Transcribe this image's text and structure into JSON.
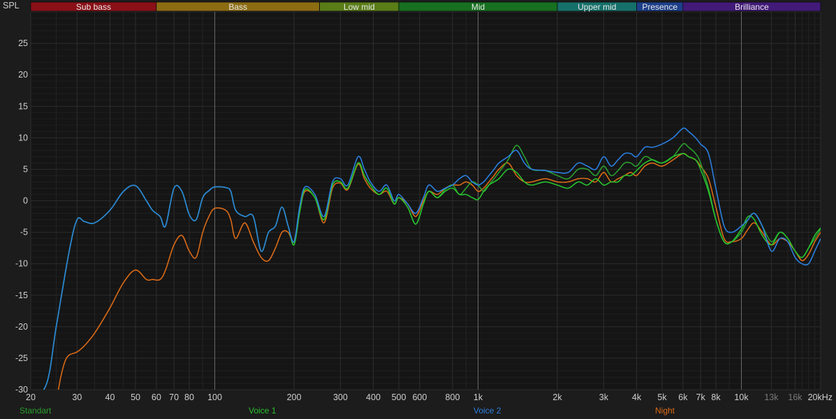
{
  "chart_data": {
    "type": "line",
    "ylabel": "SPL",
    "x_unit_label": "20kHz",
    "x_scale": "log",
    "xlim": [
      20,
      20000
    ],
    "ylim": [
      -30,
      30
    ],
    "grid": true,
    "y_ticks": [
      25,
      20,
      15,
      10,
      5,
      0,
      -5,
      -10,
      -15,
      -20,
      -25,
      -30
    ],
    "x_ticks": [
      {
        "v": 20,
        "label": "20",
        "dim": false
      },
      {
        "v": 30,
        "label": "30",
        "dim": false
      },
      {
        "v": 40,
        "label": "40",
        "dim": false
      },
      {
        "v": 50,
        "label": "50",
        "dim": false
      },
      {
        "v": 60,
        "label": "60",
        "dim": false
      },
      {
        "v": 70,
        "label": "70",
        "dim": false
      },
      {
        "v": 80,
        "label": "80",
        "dim": false
      },
      {
        "v": 100,
        "label": "100",
        "dim": false
      },
      {
        "v": 200,
        "label": "200",
        "dim": false
      },
      {
        "v": 300,
        "label": "300",
        "dim": false
      },
      {
        "v": 400,
        "label": "400",
        "dim": false
      },
      {
        "v": 500,
        "label": "500",
        "dim": false
      },
      {
        "v": 600,
        "label": "600",
        "dim": false
      },
      {
        "v": 800,
        "label": "800",
        "dim": false
      },
      {
        "v": 1000,
        "label": "1k",
        "dim": false
      },
      {
        "v": 2000,
        "label": "2k",
        "dim": false
      },
      {
        "v": 3000,
        "label": "3k",
        "dim": false
      },
      {
        "v": 4000,
        "label": "4k",
        "dim": false
      },
      {
        "v": 5000,
        "label": "5k",
        "dim": false
      },
      {
        "v": 6000,
        "label": "6k",
        "dim": false
      },
      {
        "v": 7000,
        "label": "7k",
        "dim": false
      },
      {
        "v": 8000,
        "label": "8k",
        "dim": false
      },
      {
        "v": 10000,
        "label": "10k",
        "dim": false
      },
      {
        "v": 13000,
        "label": "13k",
        "dim": true
      },
      {
        "v": 16000,
        "label": "16k",
        "dim": true
      },
      {
        "v": 20000,
        "label": "20kHz",
        "dim": false
      }
    ],
    "bands": [
      {
        "name": "Sub bass",
        "from": 20,
        "to": 60,
        "color": "#8a1017"
      },
      {
        "name": "Bass",
        "from": 60,
        "to": 250,
        "color": "#8c6d12"
      },
      {
        "name": "Low mid",
        "from": 250,
        "to": 500,
        "color": "#5a7d18"
      },
      {
        "name": "Mid",
        "from": 500,
        "to": 2000,
        "color": "#17701f"
      },
      {
        "name": "Upper mid",
        "from": 2000,
        "to": 4000,
        "color": "#16706a"
      },
      {
        "name": "Presence",
        "from": 4000,
        "to": 6000,
        "color": "#1d3f8a"
      },
      {
        "name": "Brilliance",
        "from": 6000,
        "to": 20000,
        "color": "#421a78"
      }
    ],
    "series": [
      {
        "name": "Standart",
        "color": "#2a9e2e",
        "x": [
          20,
          23,
          25,
          28,
          30,
          32,
          35,
          40,
          45,
          50,
          55,
          58,
          62,
          65,
          70,
          75,
          80,
          85,
          90,
          95,
          100,
          110,
          115,
          120,
          130,
          140,
          150,
          160,
          170,
          180,
          190,
          200,
          210,
          220,
          240,
          260,
          280,
          300,
          320,
          350,
          370,
          390,
          420,
          450,
          480,
          500,
          540,
          580,
          620,
          650,
          700,
          750,
          800,
          850,
          900,
          950,
          1000,
          1050,
          1100,
          1150,
          1200,
          1300,
          1400,
          1500,
          1600,
          1800,
          2000,
          2200,
          2400,
          2600,
          2800,
          3000,
          3200,
          3400,
          3600,
          3800,
          4000,
          4300,
          4600,
          5000,
          5500,
          6000,
          6300,
          6700,
          7000,
          7500,
          8000,
          8600,
          9200,
          10000,
          10600,
          11200,
          12000,
          13000,
          14000,
          15000,
          16000,
          17000,
          18000,
          19000,
          20000
        ],
        "y": [
          -32,
          -29,
          -20,
          -8,
          -3,
          -3.3,
          -3.5,
          -1.5,
          1.5,
          2.4,
          0,
          -1.5,
          -2.5,
          -4,
          2,
          1.5,
          -2.2,
          -3,
          0.5,
          1.6,
          2.2,
          2.1,
          1.5,
          -1.5,
          -2.5,
          -2.5,
          -8,
          -5,
          -4,
          -1,
          -4,
          -7,
          -1.8,
          1.8,
          0.5,
          -3,
          2.5,
          3,
          2,
          6,
          4,
          2.5,
          1,
          2,
          -0.5,
          0.5,
          -1,
          -3.7,
          -0.5,
          1.5,
          0.5,
          1.8,
          2.5,
          1,
          2,
          3,
          2.5,
          1.5,
          2.5,
          3.5,
          4.5,
          6.5,
          8.8,
          7,
          5,
          4.8,
          4,
          3.5,
          5,
          5,
          4,
          5.5,
          4,
          4.8,
          6,
          6,
          5.5,
          7,
          6.5,
          6,
          7,
          9,
          8.5,
          7.5,
          6,
          2,
          -3,
          -6.5,
          -6.5,
          -5,
          -3,
          -2,
          -4,
          -6.5,
          -5,
          -6,
          -8,
          -9,
          -7.5,
          -6,
          -4.5
        ]
      },
      {
        "name": "Voice 1",
        "color": "#27c22e",
        "x": [
          20,
          23,
          25,
          28,
          30,
          32,
          35,
          40,
          45,
          50,
          55,
          58,
          62,
          65,
          70,
          75,
          80,
          85,
          90,
          95,
          100,
          110,
          115,
          120,
          130,
          140,
          150,
          160,
          170,
          180,
          190,
          200,
          210,
          220,
          240,
          260,
          280,
          300,
          320,
          350,
          370,
          390,
          420,
          450,
          480,
          500,
          540,
          580,
          620,
          650,
          700,
          750,
          800,
          850,
          900,
          950,
          1000,
          1050,
          1100,
          1150,
          1200,
          1300,
          1400,
          1500,
          1600,
          1800,
          2000,
          2200,
          2400,
          2600,
          2800,
          3000,
          3200,
          3400,
          3600,
          3800,
          4000,
          4300,
          4600,
          5000,
          5500,
          6000,
          6300,
          6700,
          7000,
          7500,
          8000,
          8600,
          9200,
          10000,
          10600,
          11200,
          12000,
          13000,
          14000,
          15000,
          16000,
          17000,
          18000,
          19000,
          20000
        ],
        "y": [
          -32,
          -29,
          -20,
          -8,
          -3,
          -3.3,
          -3.5,
          -1.5,
          1.5,
          2.4,
          0,
          -1.5,
          -2.5,
          -4,
          2,
          1.5,
          -2.2,
          -3,
          0.5,
          1.6,
          2.2,
          2.1,
          1.5,
          -1.5,
          -2.5,
          -2.5,
          -8,
          -5,
          -4,
          -1,
          -4,
          -7,
          -1.8,
          1.8,
          0.5,
          -3,
          2.5,
          3,
          2,
          6,
          4,
          2.5,
          1,
          2,
          -0.5,
          0.5,
          -1,
          -3.7,
          -0.5,
          1.5,
          0.5,
          1.5,
          2,
          1,
          1,
          0.5,
          0.2,
          1.5,
          2.5,
          3,
          3.5,
          5,
          4.5,
          3,
          2.5,
          3,
          2.5,
          2,
          3,
          2.5,
          3.5,
          2.5,
          3,
          3,
          4,
          4,
          4.8,
          6,
          6.5,
          6,
          7,
          7.5,
          7,
          6.5,
          5,
          1.5,
          -3,
          -6.5,
          -6.5,
          -4.5,
          -2.5,
          -3,
          -5.5,
          -7,
          -5,
          -6,
          -8,
          -9,
          -7.5,
          -5.5,
          -4.3
        ]
      },
      {
        "name": "Voice 2",
        "color": "#2b7fe0",
        "x": [
          20,
          23,
          25,
          28,
          30,
          32,
          35,
          40,
          45,
          50,
          55,
          58,
          62,
          65,
          70,
          75,
          80,
          85,
          90,
          95,
          100,
          110,
          115,
          120,
          130,
          140,
          150,
          160,
          170,
          180,
          190,
          200,
          210,
          220,
          240,
          260,
          280,
          300,
          320,
          350,
          370,
          390,
          420,
          450,
          480,
          500,
          540,
          580,
          620,
          650,
          700,
          750,
          800,
          850,
          900,
          950,
          1000,
          1050,
          1100,
          1150,
          1200,
          1300,
          1400,
          1500,
          1600,
          1800,
          2000,
          2200,
          2400,
          2600,
          2800,
          3000,
          3200,
          3400,
          3600,
          3800,
          4000,
          4300,
          4600,
          5000,
          5500,
          6000,
          6300,
          6700,
          7000,
          7500,
          8000,
          8600,
          9200,
          10000,
          10600,
          11200,
          12000,
          13000,
          14000,
          15000,
          16000,
          17000,
          18000,
          19000,
          20000
        ],
        "y": [
          -32,
          -29,
          -20,
          -8,
          -3,
          -3.3,
          -3.5,
          -1.5,
          1.5,
          2.4,
          0,
          -1.5,
          -2.5,
          -4,
          2,
          1.5,
          -2.2,
          -3,
          0.5,
          1.6,
          2.2,
          2.1,
          1.5,
          -1.5,
          -2.5,
          -2.5,
          -8,
          -5,
          -4,
          -1,
          -4,
          -6.5,
          -1,
          2.2,
          1,
          -2.5,
          3,
          3.5,
          2.5,
          7,
          5,
          3,
          1.5,
          2.5,
          0,
          1,
          -0.5,
          -2,
          0.5,
          2.5,
          1.5,
          2,
          2.5,
          3.5,
          4,
          3,
          2.5,
          3,
          4,
          5,
          6,
          7,
          8,
          6,
          5,
          4.8,
          4.5,
          4.5,
          6,
          5.5,
          5,
          7,
          5.5,
          6.5,
          7.5,
          7.5,
          7,
          8.5,
          8.5,
          9,
          10,
          11.5,
          11,
          10,
          9,
          7.5,
          2,
          -4,
          -5,
          -4,
          -3,
          -2,
          -4,
          -8,
          -6,
          -6.5,
          -9,
          -10,
          -10,
          -8,
          -6
        ]
      },
      {
        "name": "Night",
        "color": "#d96a17",
        "x": [
          25,
          26,
          27,
          28,
          30,
          32,
          35,
          40,
          45,
          50,
          55,
          58,
          62,
          65,
          70,
          75,
          80,
          85,
          90,
          95,
          100,
          110,
          115,
          120,
          130,
          140,
          150,
          160,
          170,
          180,
          190,
          200,
          210,
          220,
          240,
          260,
          280,
          300,
          320,
          350,
          370,
          390,
          420,
          450,
          480,
          500,
          540,
          580,
          620,
          650,
          700,
          750,
          800,
          850,
          900,
          950,
          1000,
          1050,
          1100,
          1150,
          1200,
          1300,
          1400,
          1500,
          1600,
          1800,
          2000,
          2200,
          2400,
          2600,
          2800,
          3000,
          3200,
          3400,
          3600,
          3800,
          4000,
          4300,
          4600,
          5000,
          5500,
          6000,
          6300,
          6700,
          7000,
          7500,
          8000,
          8600,
          9200,
          10000,
          10600,
          11200,
          12000,
          13000,
          14000,
          15000,
          16000,
          17000,
          18000,
          19000,
          20000
        ],
        "y": [
          -32,
          -28,
          -25.5,
          -24.5,
          -24,
          -23,
          -21,
          -17,
          -13,
          -11,
          -12.5,
          -12.5,
          -12.5,
          -11,
          -7,
          -5.5,
          -8,
          -9,
          -5,
          -2.5,
          -1.2,
          -1.5,
          -3,
          -6,
          -3.5,
          -6.5,
          -9,
          -9.5,
          -7.5,
          -5,
          -5,
          -6.5,
          -1.8,
          1.5,
          0.5,
          -3.5,
          2,
          2.8,
          1.8,
          5.8,
          3.5,
          2,
          1,
          1.5,
          -0.5,
          0.5,
          -0.5,
          -2.5,
          0,
          1.5,
          1,
          2,
          2.5,
          2.5,
          3,
          2.5,
          1.5,
          2,
          3,
          4,
          5,
          6,
          4,
          3,
          3,
          3.5,
          3,
          3,
          3.5,
          3.5,
          3,
          4.5,
          3,
          3.5,
          4,
          4.5,
          4,
          5.5,
          6,
          5.5,
          6.5,
          7.5,
          7,
          6.5,
          5.5,
          3.5,
          -1,
          -6,
          -6.5,
          -6,
          -4.5,
          -3.5,
          -5,
          -7,
          -6,
          -6.5,
          -8,
          -9.5,
          -8.5,
          -6.5,
          -5
        ]
      }
    ]
  }
}
